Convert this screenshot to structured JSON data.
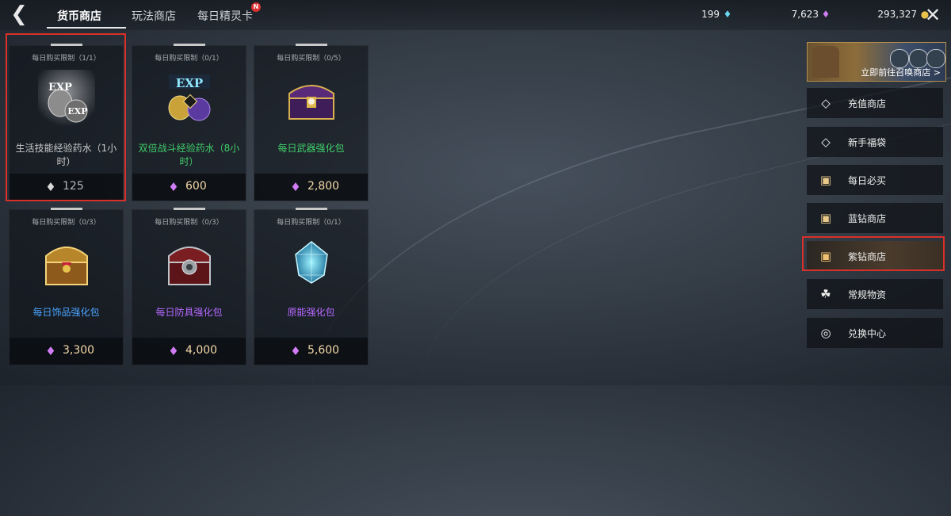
{
  "header": {
    "back_icon": "back-arrow-icon",
    "tabs": [
      {
        "label": "货币商店",
        "active": true
      },
      {
        "label": "玩法商店",
        "active": false
      },
      {
        "label": "每日精灵卡",
        "active": false,
        "badge": "N"
      }
    ],
    "currencies": [
      {
        "value": "199",
        "icon": "blue-diamond-icon"
      },
      {
        "value": "7,623",
        "icon": "purple-diamond-icon"
      },
      {
        "value": "293,327",
        "icon": "gold-coin-icon"
      }
    ],
    "close_icon": "close-icon"
  },
  "products": [
    {
      "limit": "每日购买限制（1/1）",
      "name": "生活技能经验药水（1小时）",
      "price": "125",
      "name_color": "#c9c9c9",
      "price_icon": "silver-diamond-icon",
      "art": "exp-potion-silver",
      "selected": true
    },
    {
      "limit": "每日购买限制（0/1）",
      "name": "双倍战斗经验药水（8小时）",
      "price": "600",
      "name_color": "#3fcf6a",
      "price_icon": "purple-diamond-icon",
      "art": "exp-potion-gold"
    },
    {
      "limit": "每日购买限制（0/5）",
      "name": "每日武器强化包",
      "price": "2,800",
      "name_color": "#3fcf6a",
      "price_icon": "purple-diamond-icon",
      "art": "purple-chest"
    },
    {
      "limit": "每日购买限制（0/3）",
      "name": "每日饰品强化包",
      "price": "3,300",
      "name_color": "#4aa3ff",
      "price_icon": "purple-diamond-icon",
      "art": "gold-chest"
    },
    {
      "limit": "每日购买限制（0/3）",
      "name": "每日防具强化包",
      "price": "4,000",
      "name_color": "#b668ff",
      "price_icon": "purple-diamond-icon",
      "art": "red-chest"
    },
    {
      "limit": "每日购买限制（0/1）",
      "name": "原能强化包",
      "price": "5,600",
      "name_color": "#b668ff",
      "price_icon": "purple-diamond-icon",
      "art": "blue-crystal"
    }
  ],
  "sidebar": {
    "banner_text": "立即前往召唤商店 >",
    "items": [
      {
        "label": "充值商店",
        "icon": "diamond-icon"
      },
      {
        "label": "新手福袋",
        "icon": "diamond-icon"
      },
      {
        "label": "每日必买",
        "icon": "gift-icon"
      },
      {
        "label": "蓝钻商店",
        "icon": "gift-icon"
      },
      {
        "label": "紫钻商店",
        "icon": "gift-icon",
        "active": true
      },
      {
        "label": "常规物资",
        "icon": "bag-icon"
      },
      {
        "label": "兑换中心",
        "icon": "coin-icon"
      }
    ]
  },
  "colors": {
    "highlight": "#d9302a",
    "price_text": "#f3d9a8",
    "blue_diamond": "#68d8f0",
    "purple_diamond": "#d07cf5",
    "gold_coin": "#e9c34b"
  }
}
